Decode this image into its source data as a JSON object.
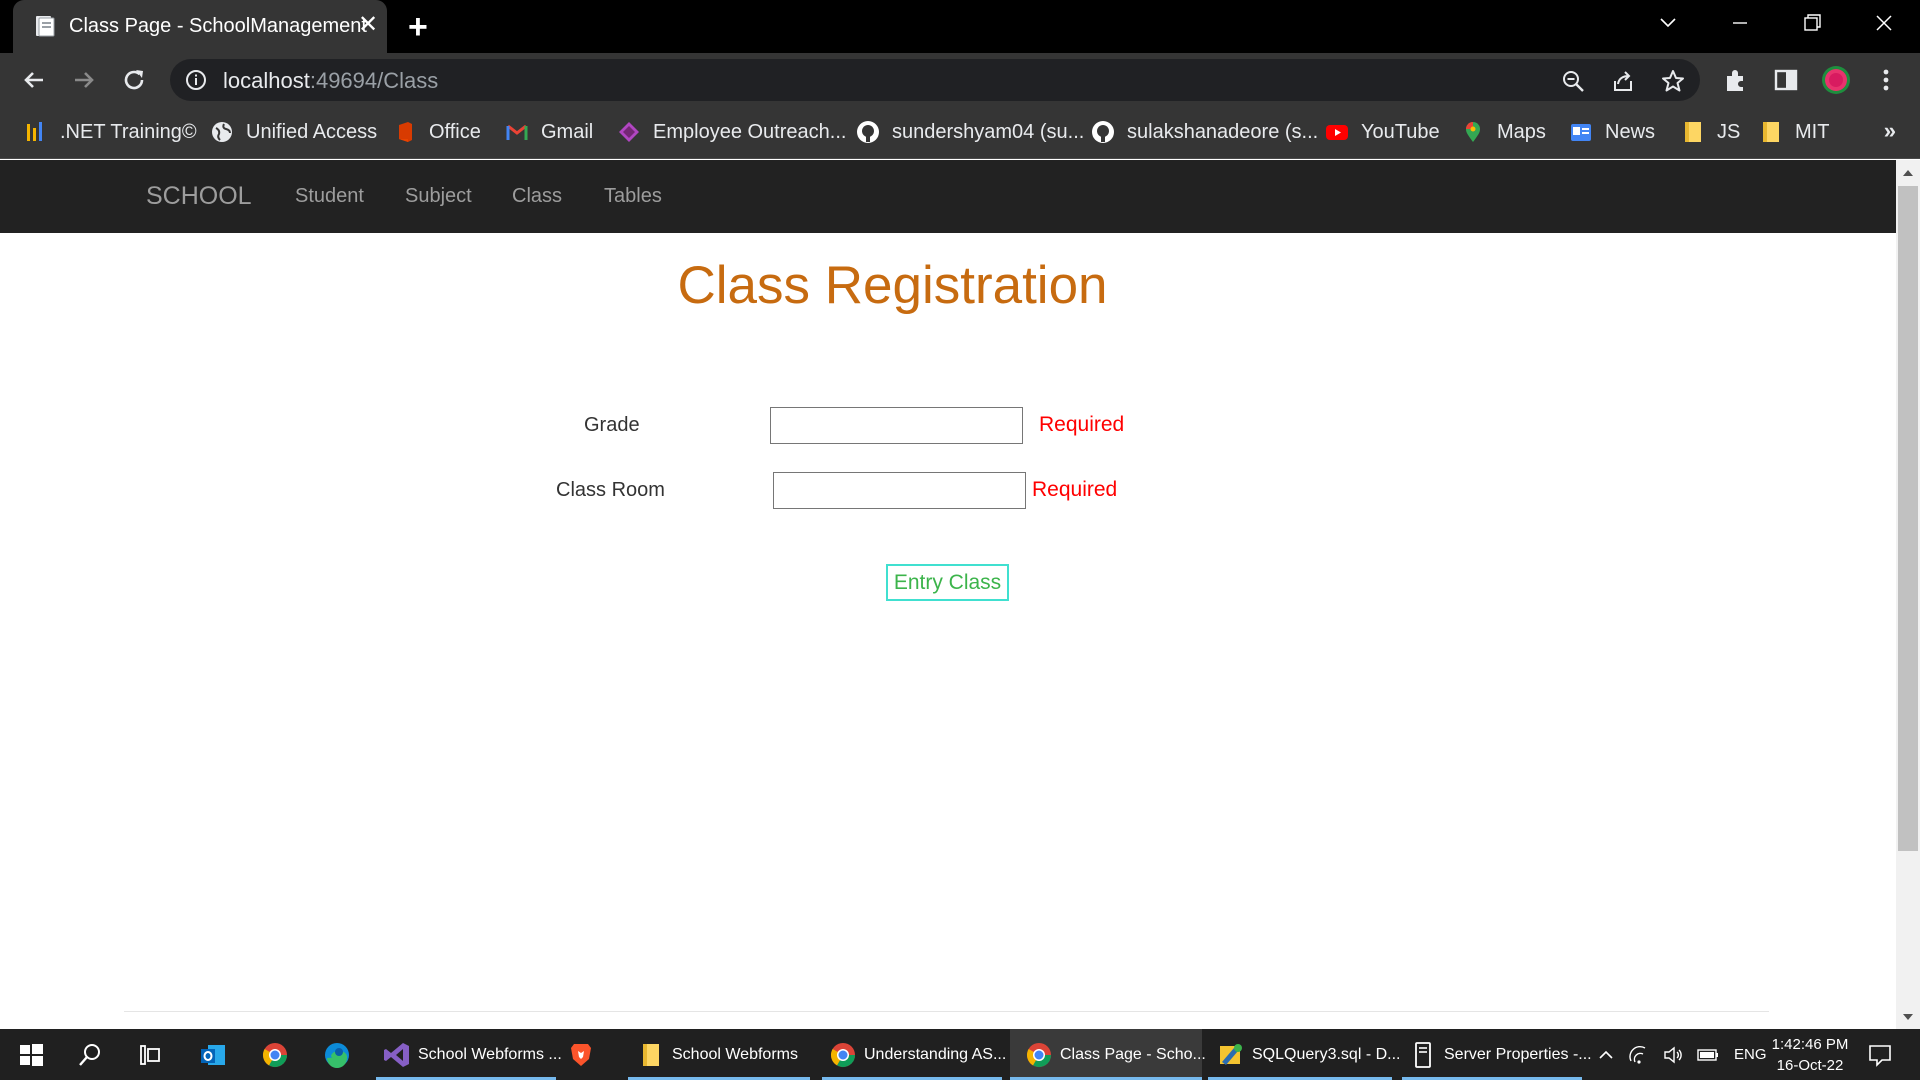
{
  "browser": {
    "tab_title": "Class Page - SchoolManagement",
    "url_host": "localhost",
    "url_rest": ":49694/Class",
    "bookmarks": [
      {
        "label": ".NET Training©",
        "icon": "bars-chart-icon"
      },
      {
        "label": "Unified Access",
        "icon": "globe-icon"
      },
      {
        "label": "Office",
        "icon": "office-icon"
      },
      {
        "label": "Gmail",
        "icon": "gmail-icon"
      },
      {
        "label": "Employee Outreach...",
        "icon": "diamond-icon"
      },
      {
        "label": "sundershyam04 (su...",
        "icon": "github-icon"
      },
      {
        "label": "sulakshanadeore (s...",
        "icon": "github-icon"
      },
      {
        "label": "YouTube",
        "icon": "youtube-icon"
      },
      {
        "label": "Maps",
        "icon": "maps-pin-icon"
      },
      {
        "label": "News",
        "icon": "news-icon"
      },
      {
        "label": "JS",
        "icon": "folder-icon"
      },
      {
        "label": "MIT",
        "icon": "folder-icon"
      }
    ],
    "bookmarks_more": "»"
  },
  "site": {
    "brand": "SCHOOL",
    "nav": [
      "Student",
      "Subject",
      "Class",
      "Tables"
    ]
  },
  "form": {
    "title": "Class Registration",
    "grade_label": "Grade",
    "grade_value": "",
    "grade_error": "Required",
    "room_label": "Class Room",
    "room_value": "",
    "room_error": "Required",
    "submit_label": "Entry Class"
  },
  "taskbar": {
    "apps": [
      {
        "label": "School Webforms ...",
        "icon": "visual-studio-icon"
      },
      {
        "label": "School Webforms",
        "icon": "folder-icon"
      },
      {
        "label": "Understanding AS...",
        "icon": "chrome-icon"
      },
      {
        "label": "Class Page - Scho...",
        "icon": "chrome-icon"
      },
      {
        "label": "SQLQuery3.sql - D...",
        "icon": "ssms-icon"
      },
      {
        "label": "Server Properties -...",
        "icon": "server-icon"
      }
    ],
    "language": "ENG",
    "time": "1:42:46 PM",
    "date": "16-Oct-22"
  },
  "colors": {
    "title": "#c76b10",
    "error": "#ff0000",
    "button_text": "#3cb44b",
    "button_border": "#40e0d0",
    "navbar": "#222222"
  }
}
